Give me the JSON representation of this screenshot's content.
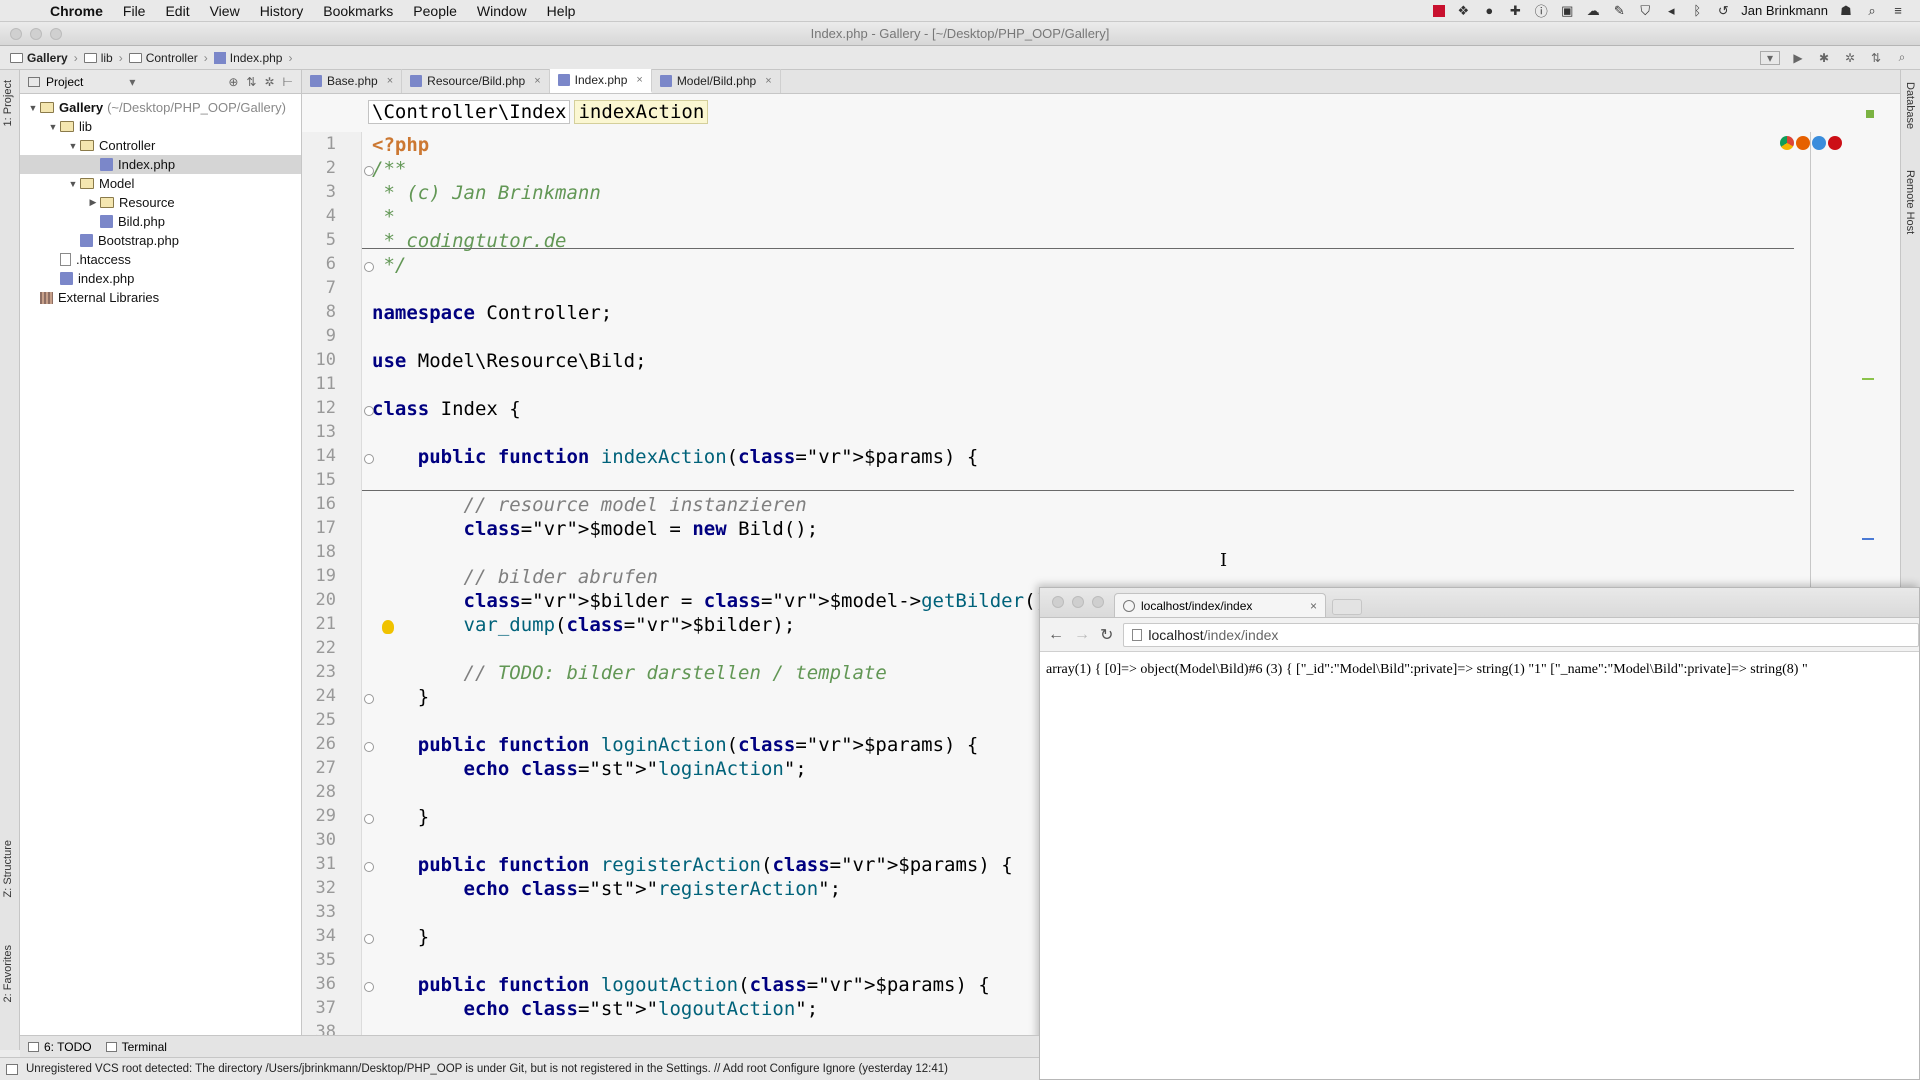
{
  "menubar": {
    "app_name": "Chrome",
    "items": [
      "File",
      "Edit",
      "View",
      "History",
      "Bookmarks",
      "People",
      "Window",
      "Help"
    ],
    "user_name": "Jan Brinkmann"
  },
  "window": {
    "title": "Index.php - Gallery - [~/Desktop/PHP_OOP/Gallery]"
  },
  "breadcrumb": [
    "Gallery",
    "lib",
    "Controller",
    "Index.php"
  ],
  "tool_tabs": {
    "project": "1: Project",
    "structure": "Z: Structure",
    "favorites": "2: Favorites",
    "database": "Database",
    "remote_host": "Remote Host"
  },
  "project_panel": {
    "header": "Project",
    "tree": [
      {
        "label": "Gallery",
        "extra": "(~/Desktop/PHP_OOP/Gallery)",
        "type": "folder",
        "indent": 0,
        "arrow": "▼"
      },
      {
        "label": "lib",
        "type": "folder",
        "indent": 1,
        "arrow": "▼"
      },
      {
        "label": "Controller",
        "type": "folder",
        "indent": 2,
        "arrow": "▼"
      },
      {
        "label": "Index.php",
        "type": "php",
        "indent": 3,
        "selected": true
      },
      {
        "label": "Model",
        "type": "folder",
        "indent": 2,
        "arrow": "▼"
      },
      {
        "label": "Resource",
        "type": "folder",
        "indent": 3,
        "arrow": "▶"
      },
      {
        "label": "Bild.php",
        "type": "php",
        "indent": 3
      },
      {
        "label": "Bootstrap.php",
        "type": "php",
        "indent": 2
      },
      {
        "label": ".htaccess",
        "type": "file",
        "indent": 1
      },
      {
        "label": "index.php",
        "type": "php",
        "indent": 1
      },
      {
        "label": "External Libraries",
        "type": "lib",
        "indent": 0
      }
    ]
  },
  "editor_tabs": [
    {
      "label": "Base.php",
      "active": false
    },
    {
      "label": "Resource/Bild.php",
      "active": false
    },
    {
      "label": "Index.php",
      "active": true
    },
    {
      "label": "Model/Bild.php",
      "active": false
    }
  ],
  "structure_path": {
    "namespace": "\\Controller\\Index",
    "method": "indexAction"
  },
  "code_lines": [
    "<?php",
    "/**",
    " * (c) Jan Brinkmann",
    " *",
    " * codingtutor.de",
    " */",
    "",
    "namespace Controller;",
    "",
    "use Model\\Resource\\Bild;",
    "",
    "class Index {",
    "",
    "    public function indexAction($params) {",
    "",
    "        // resource model instanzieren",
    "        $model = new Bild();",
    "",
    "        // bilder abrufen",
    "        $bilder = $model->getBilder();",
    "        var_dump($bilder);",
    "",
    "        // TODO: bilder darstellen / template",
    "    }",
    "",
    "    public function loginAction($params) {",
    "        echo \"loginAction\";",
    "",
    "    }",
    "",
    "    public function registerAction($params) {",
    "        echo \"registerAction\";",
    "",
    "    }",
    "",
    "    public function logoutAction($params) {",
    "        echo \"logoutAction\";",
    ""
  ],
  "browser": {
    "tab_title": "localhost/index/index",
    "url_host": "localhost",
    "url_path": "/index/index",
    "content": "array(1) { [0]=> object(Model\\Bild)#6 (3) { [\"_id\":\"Model\\Bild\":private]=> string(1) \"1\" [\"_name\":\"Model\\Bild\":private]=> string(8) \""
  },
  "bottom_tools": {
    "todo": "6: TODO",
    "terminal": "Terminal"
  },
  "status": {
    "message": "Unregistered VCS root detected: The directory /Users/jbrinkmann/Desktop/PHP_OOP is under Git, but is not registered in the Settings. // Add root  Configure  Ignore (yesterday 12:41)"
  }
}
